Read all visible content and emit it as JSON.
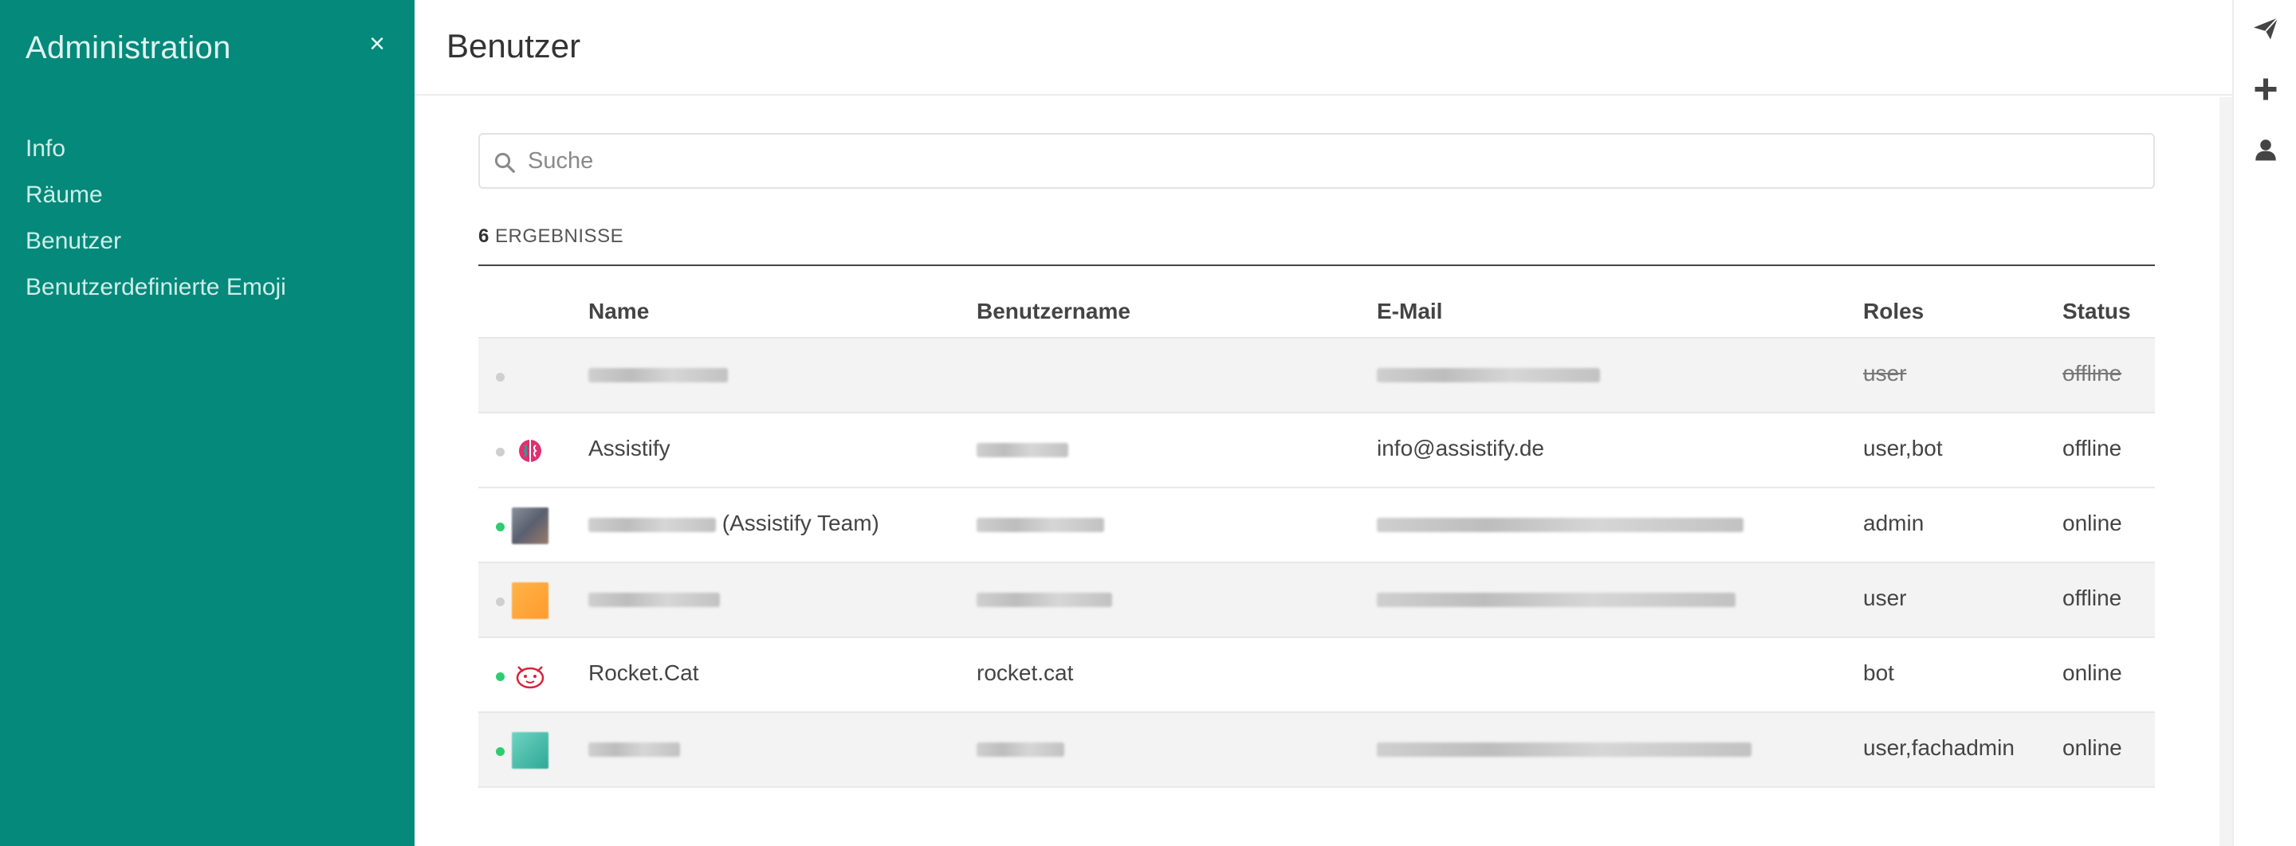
{
  "sidebar": {
    "title": "Administration",
    "close_label": "×",
    "items": [
      {
        "label": "Info"
      },
      {
        "label": "Räume"
      },
      {
        "label": "Benutzer"
      },
      {
        "label": "Benutzerdefinierte Emoji"
      }
    ]
  },
  "header": {
    "title": "Benutzer"
  },
  "search": {
    "placeholder": "Suche",
    "value": ""
  },
  "results": {
    "count": "6",
    "label": "ERGEBNISSE"
  },
  "table": {
    "columns": [
      "Name",
      "Benutzername",
      "E-Mail",
      "Roles",
      "Status"
    ],
    "rows": [
      {
        "status_dot": "offline",
        "avatar": "none",
        "name": "",
        "name_suffix": "",
        "username": "",
        "email": "",
        "roles": "user",
        "status": "offline",
        "deactivated": true
      },
      {
        "status_dot": "offline",
        "avatar": "brain-icon",
        "name": "Assistify",
        "name_suffix": "",
        "username": "",
        "email": "info@assistify.de",
        "roles": "user,bot",
        "status": "offline",
        "deactivated": false
      },
      {
        "status_dot": "online",
        "avatar": "photo",
        "name": "",
        "name_suffix": "(Assistify Team)",
        "username": "",
        "email": "",
        "roles": "admin",
        "status": "online",
        "deactivated": false
      },
      {
        "status_dot": "offline",
        "avatar": "orange-tile",
        "name": "",
        "name_suffix": "",
        "username": "",
        "email": "",
        "roles": "user",
        "status": "offline",
        "deactivated": false
      },
      {
        "status_dot": "online",
        "avatar": "cat-icon",
        "name": "Rocket.Cat",
        "name_suffix": "",
        "username": "rocket.cat",
        "email": "",
        "roles": "bot",
        "status": "online",
        "deactivated": false
      },
      {
        "status_dot": "online",
        "avatar": "teal-tile",
        "name": "",
        "name_suffix": "",
        "username": "",
        "email": "",
        "roles": "user,fachadmin",
        "status": "online",
        "deactivated": false
      }
    ]
  },
  "rail": {
    "icons": [
      "paper-plane-icon",
      "plus-icon",
      "user-icon"
    ]
  },
  "colors": {
    "sidebar": "#04897b",
    "online": "#2ecc71",
    "offline": "#cfcfcf"
  }
}
